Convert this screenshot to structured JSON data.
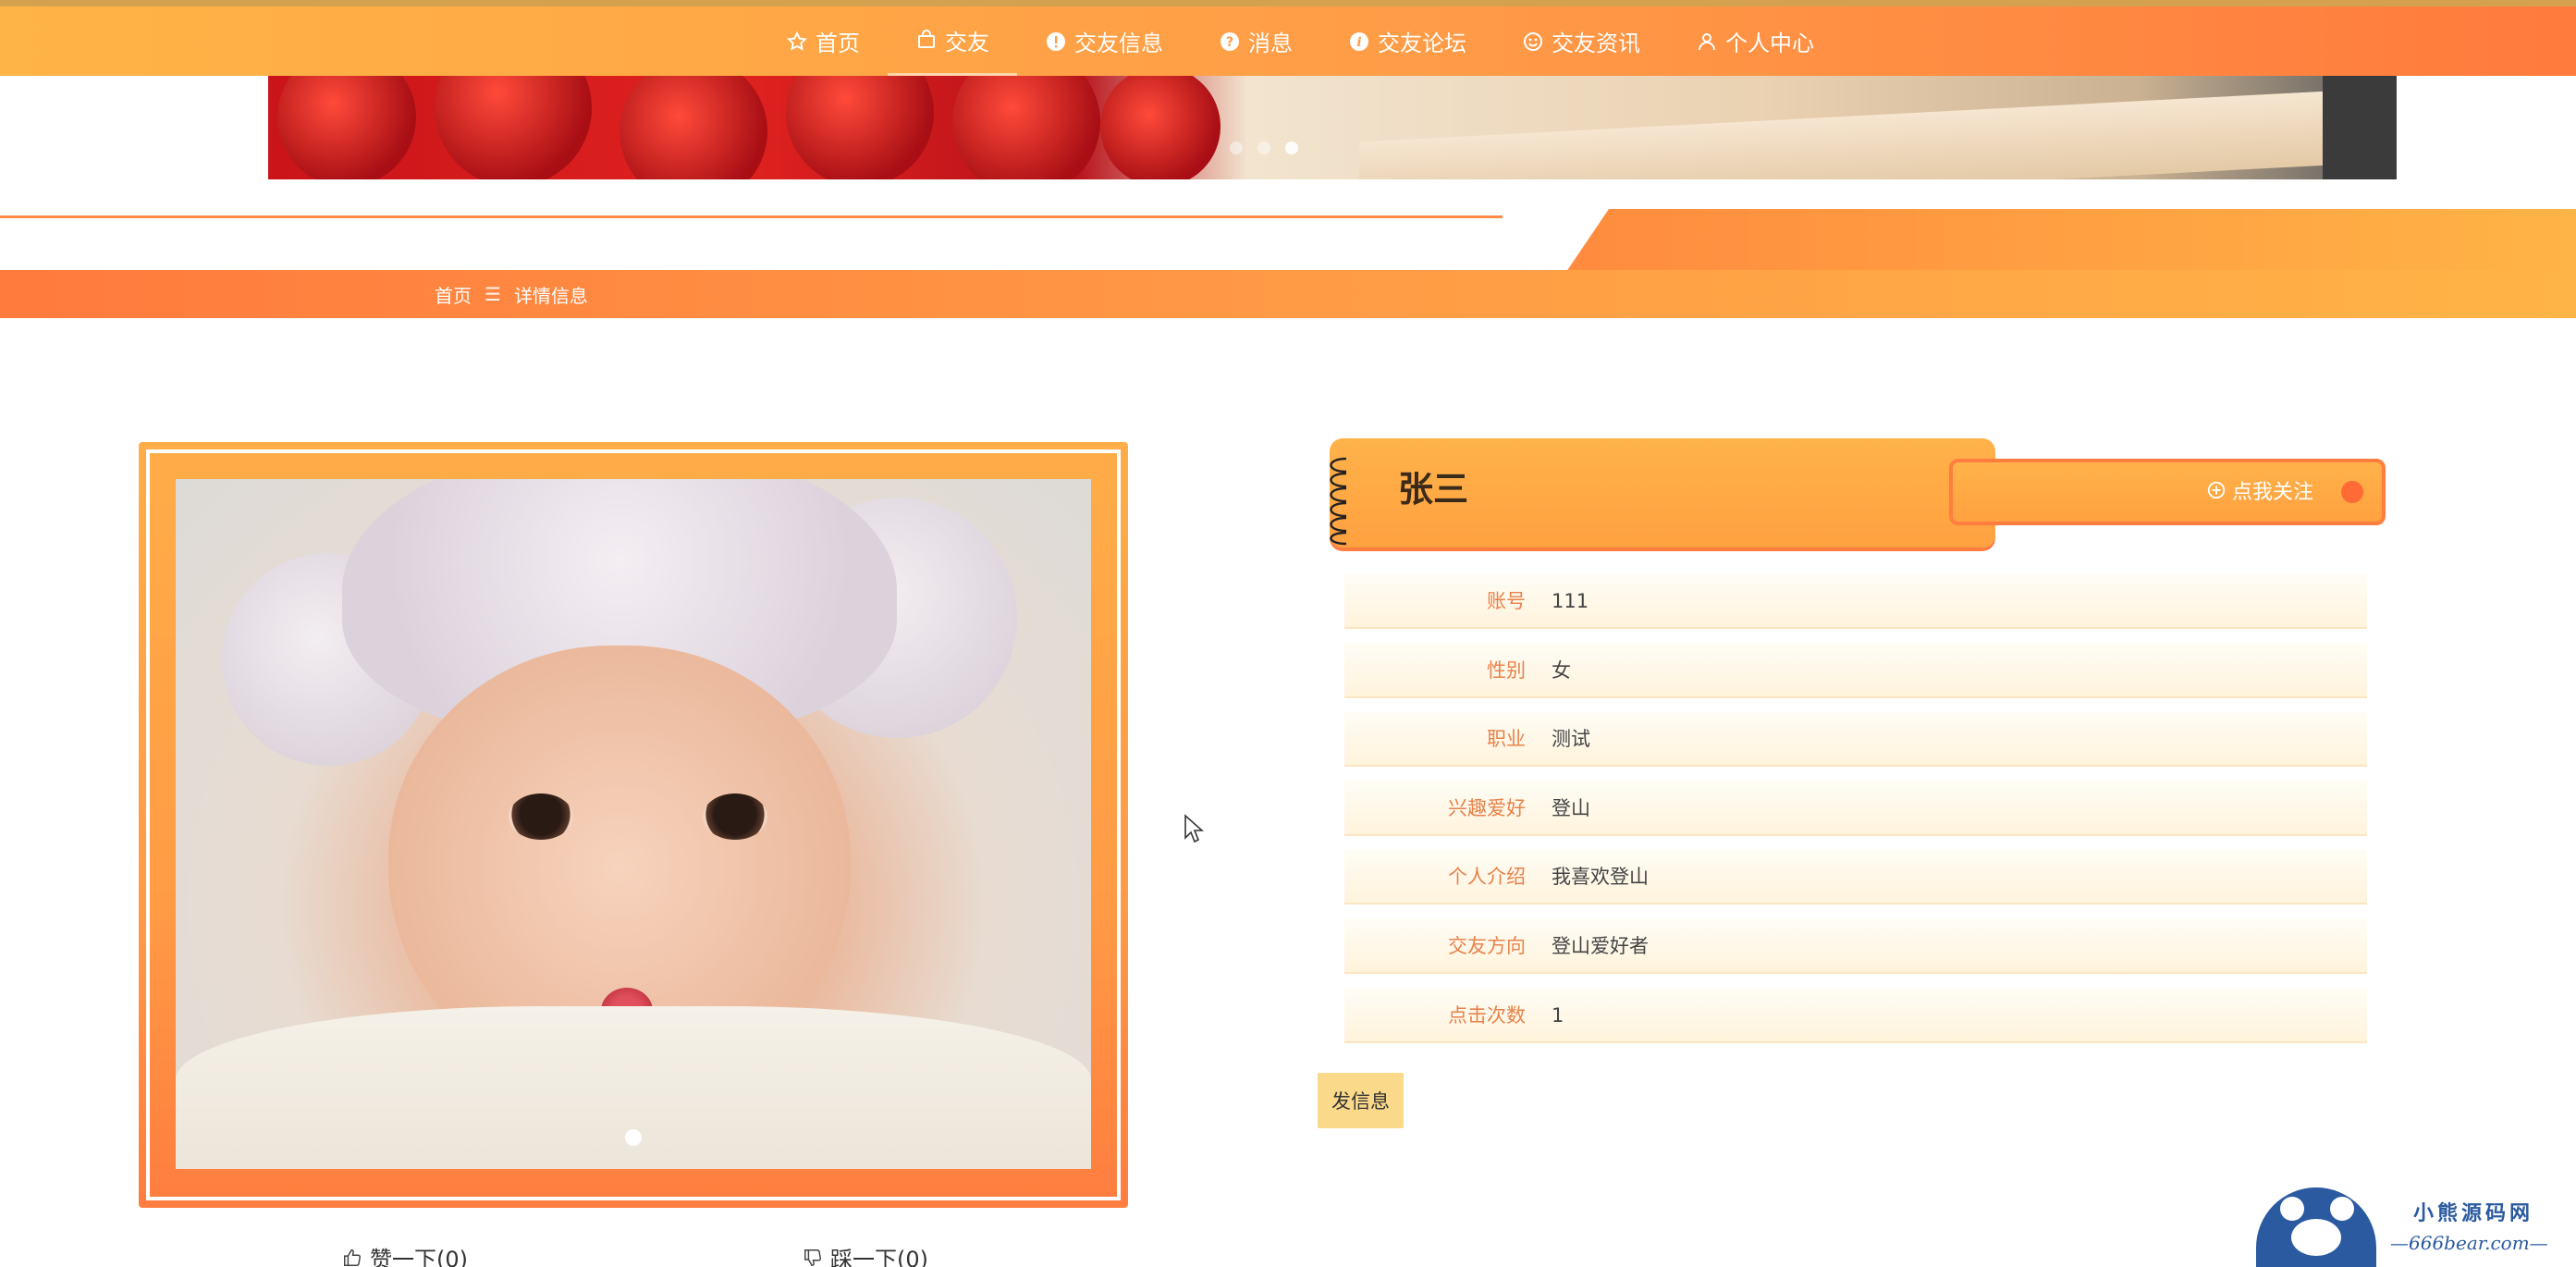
{
  "nav": {
    "items": [
      {
        "label": "首页",
        "icon": "star-icon"
      },
      {
        "label": "交友",
        "icon": "bag-icon"
      },
      {
        "label": "交友信息",
        "icon": "info-icon"
      },
      {
        "label": "消息",
        "icon": "question-icon"
      },
      {
        "label": "交友论坛",
        "icon": "info-italic-icon"
      },
      {
        "label": "交友资讯",
        "icon": "smile-icon"
      },
      {
        "label": "个人中心",
        "icon": "user-icon"
      }
    ],
    "active_index": 1
  },
  "breadcrumb": {
    "home": "首页",
    "separator": "☰",
    "current": "详情信息"
  },
  "profile": {
    "name": "张三",
    "follow_label": "点我关注",
    "fields": [
      {
        "label": "账号",
        "value": "111"
      },
      {
        "label": "性别",
        "value": "女"
      },
      {
        "label": "职业",
        "value": "测试"
      },
      {
        "label": "兴趣爱好",
        "value": "登山"
      },
      {
        "label": "个人介绍",
        "value": "我喜欢登山"
      },
      {
        "label": "交友方向",
        "value": "登山爱好者"
      },
      {
        "label": "点击次数",
        "value": "1"
      }
    ],
    "send_label": "发信息"
  },
  "votes": {
    "like_label": "赞一下(0)",
    "dislike_label": "踩一下(0)"
  },
  "watermark": {
    "title": "小熊源码网",
    "url": "—666bear.com—"
  },
  "colors": {
    "accent": "#ff9c47",
    "accent_dark": "#ff7a3d",
    "label": "#e8824a",
    "send_button": "#fbd98a"
  }
}
